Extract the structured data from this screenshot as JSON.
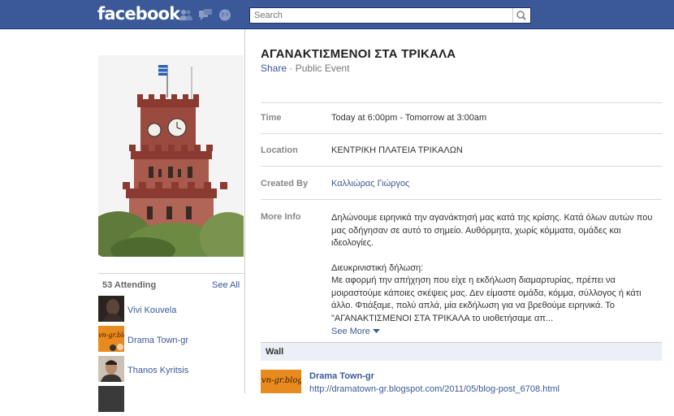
{
  "topbar": {
    "logo": "facebook",
    "icons": [
      "friend-requests-icon",
      "messages-icon",
      "notifications-globe-icon"
    ],
    "search": {
      "placeholder": "Search",
      "value": ""
    },
    "colors": {
      "bar": "#3b5998",
      "border": "#133783"
    }
  },
  "sidebar": {
    "attending_count": "53 Attending",
    "see_all": "See All",
    "attendees": [
      {
        "name": "Vivi Kouvela"
      },
      {
        "name": "Drama Town-gr",
        "thumb_text": "vn-gr.blog"
      },
      {
        "name": "Thanos Kyritsis"
      }
    ]
  },
  "event": {
    "title": "ΑΓΑΝΑΚΤΙΣΜΕΝΟΙ ΣΤΑ ΤΡΙΚΑΛΑ",
    "share": "Share",
    "separator": "·",
    "visibility": "Public Event",
    "time_label": "Time",
    "time_value": "Today at 6:00pm - Tomorrow at 3:00am",
    "location_label": "Location",
    "location_value": "ΚΕΝΤΡΙΚΗ ΠΛΑΤΕΙΑ ΤΡΙΚΑΛΩΝ",
    "created_by_label": "Created By",
    "created_by_value": "Καλλιώρας Γιώργος",
    "more_info_label": "More Info",
    "more_info_p1": "Δηλώνουμε ειρηνικά την αγανάκτησή μας κατά της κρίσης. Κατά όλων αυτών που μας οδήγησαν σε αυτό το σημείο. Αυθόρμητα, χωρίς κόμματα, ομάδες και ιδεολογίες.",
    "more_info_p2": "Διευκρινιστική δήλωση:\nΜε αφορμή την απήχηση που είχε η εκδήλωση διαμαρτυρίας, πρέπει να μοιραστούμε κάποιες σκέψεις μας. Δεν είμαστε ομάδα, κόμμα, σύλλογος ή κάτι άλλο. Φτιάξαμε, πολύ απλά, μία εκδήλωση για να βρεθούμε ειρηνικά. Το \"ΑΓΑΝΑΚΤΙΣΜΕΝΟΙ ΣΤΑ ΤΡΙΚΑΛΑ το υιοθετήσαμε απ...",
    "see_more": "See More"
  },
  "wall": {
    "heading": "Wall",
    "post_author": "Drama Town-gr",
    "post_thumb_text": "vn-gr.blog",
    "post_link": "http://dramatown-gr.blogspot.com/2011/05/blog-post_6708.html"
  },
  "colors": {
    "link": "#3b5998",
    "label": "#888888",
    "wall_bg": "#eceff5"
  }
}
